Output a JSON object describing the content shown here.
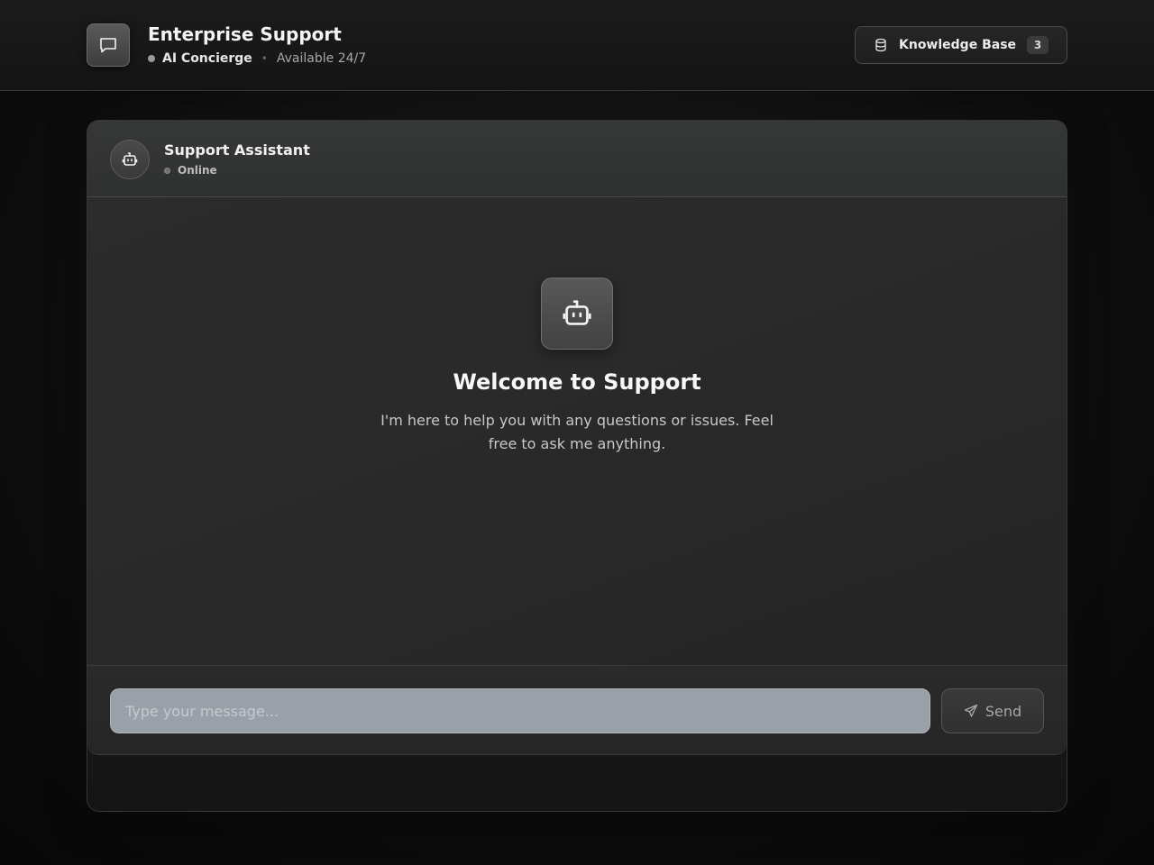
{
  "header": {
    "title": "Enterprise Support",
    "subtitle_primary": "AI Concierge",
    "subtitle_separator": "•",
    "subtitle_secondary": "Available 24/7",
    "brand_icon": "chat-bubble-icon",
    "knowledge_base": {
      "label": "Knowledge Base",
      "count": "3",
      "icon": "database-icon"
    }
  },
  "chat": {
    "agent_name": "Support Assistant",
    "agent_status": "Online",
    "agent_icon": "robot-icon",
    "welcome": {
      "title": "Welcome to Support",
      "text": "I'm here to help you with any questions or issues. Feel free to ask me anything.",
      "icon": "robot-icon"
    },
    "composer": {
      "placeholder": "Type your message...",
      "value": "",
      "send_label": "Send",
      "send_icon": "paper-plane-icon"
    }
  }
}
